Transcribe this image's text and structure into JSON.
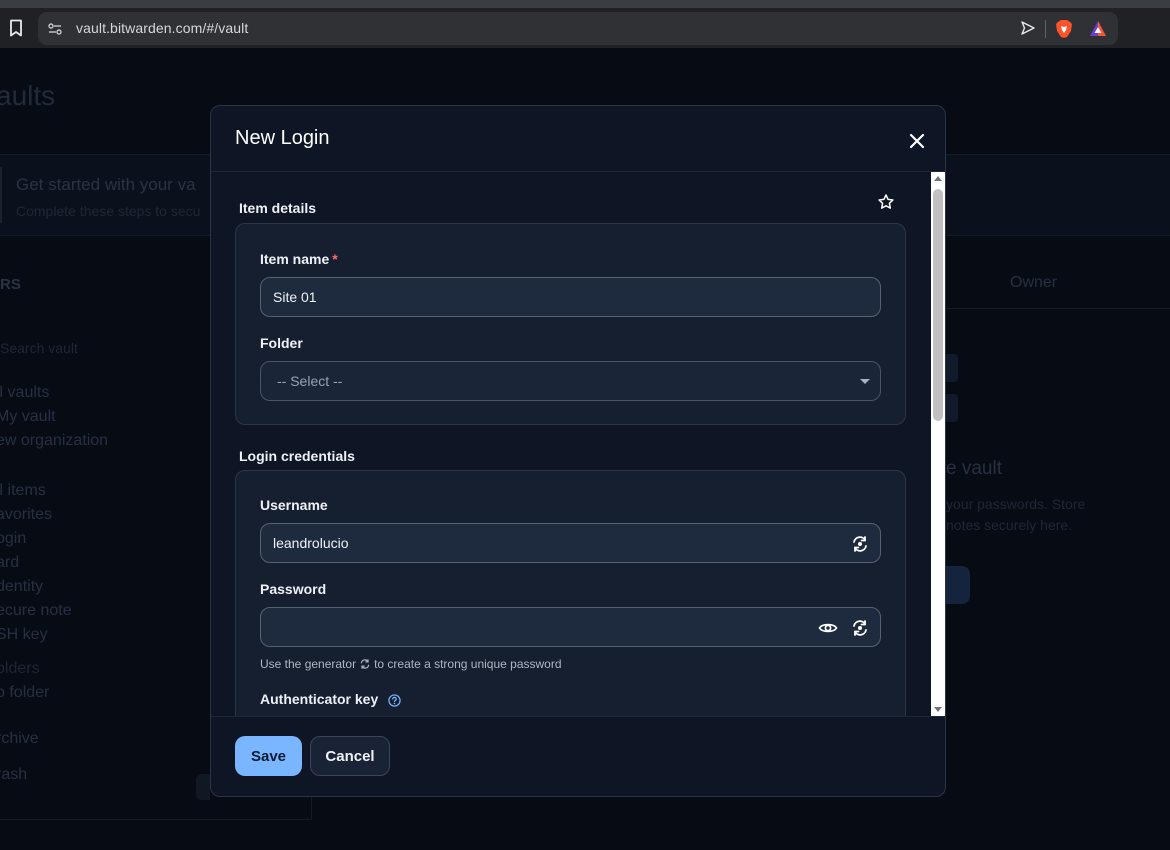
{
  "browser": {
    "url": "vault.bitwarden.com/#/vault"
  },
  "background": {
    "page_title": "aults",
    "banner_title": "Get started with your va",
    "banner_subtitle": "Complete these steps to secu",
    "filters_heading": "RS",
    "search_placeholder": "Search vault",
    "vaults": [
      "ll vaults",
      "My vault",
      "ew organization"
    ],
    "types": [
      "ll items",
      "avorites",
      "ogin",
      "ard",
      "dentity",
      "ecure note",
      "SH key"
    ],
    "folders_heading": "olders",
    "no_folder": "o folder",
    "archive": "rchive",
    "trash": "rash",
    "owner_column": "Owner",
    "empty_title": "e vault",
    "empty_line1": "your passwords. Store",
    "empty_line2": "notes securely here."
  },
  "dialog": {
    "title": "New Login",
    "item_details": {
      "heading": "Item details",
      "item_name_label": "Item name",
      "required_marker": "*",
      "item_name_value": "Site 01",
      "folder_label": "Folder",
      "folder_value": "-- Select --"
    },
    "login_credentials": {
      "heading": "Login credentials",
      "username_label": "Username",
      "username_value": "leandrolucio",
      "password_label": "Password",
      "password_value": "",
      "hint_before": "Use the generator",
      "hint_after": "to create a strong unique password",
      "authenticator_label": "Authenticator key"
    },
    "footer": {
      "save_label": "Save",
      "cancel_label": "Cancel"
    }
  },
  "colors": {
    "primary_button": "#79b6ff",
    "dialog_background": "#0e1626",
    "card_background": "#161f30",
    "required_marker": "#ff6b6b"
  },
  "icons": [
    "bookmark-icon",
    "site-info-icon",
    "send-icon",
    "brave-shield-icon",
    "brave-rewards-icon",
    "close-icon",
    "star-icon",
    "generate-icon",
    "eye-icon",
    "help-icon"
  ]
}
